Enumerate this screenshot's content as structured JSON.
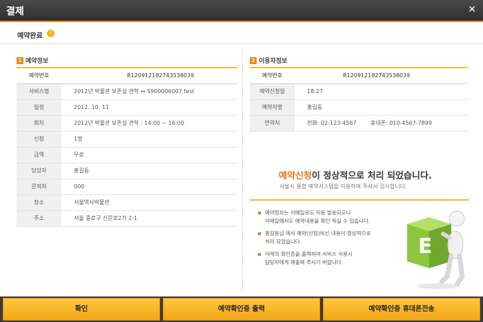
{
  "window": {
    "title": "결제",
    "close_glyph": "✕"
  },
  "header": {
    "label": "예약완료"
  },
  "reservation": {
    "section_num": "1",
    "section_title": "예약정보",
    "number_label": "예약번호",
    "number_value": "R120912182743538039",
    "rows": [
      {
        "label": "서비스명",
        "value": "2012년 박물관 보존실 견학 ↔ S900006007 test"
      },
      {
        "label": "일정",
        "value": "2012. 10. 11"
      },
      {
        "label": "회차",
        "value": "2012년 박물관 보존실 견학 : 14:00 ~ 16:00"
      },
      {
        "label": "신청",
        "value": "1명"
      },
      {
        "label": "금액",
        "value": "무료"
      },
      {
        "label": "담당자",
        "value": "홍길동"
      },
      {
        "label": "문의처",
        "value": "000"
      },
      {
        "label": "장소",
        "value": "서울역사박물관"
      },
      {
        "label": "주소",
        "value": "서울 중로구 신문로2가 2-1"
      }
    ]
  },
  "user": {
    "section_num": "2",
    "section_title": "이용자정보",
    "number_label": "예약번호",
    "number_value": "R120912182743538039",
    "rows": [
      {
        "label": "예약신청일",
        "value": "18:27"
      },
      {
        "label": "예약자명",
        "value": "홍길동"
      },
      {
        "label": "연락처",
        "value": "전화: 02-123-4567        휴대폰: 010-4567-7899"
      }
    ]
  },
  "message": {
    "main_highlight": "예약신청",
    "main_rest": "이 정상적으로 처리 되었습니다.",
    "sub": "서울시 통합 예약시스템을 이용하여 주셔서 감사합니다."
  },
  "notices": [
    {
      "line1": "예약정보는 이메일로도 자동 발송되오니",
      "line2": "이메일에서도 예약내용을 확인 하실 수 있습니다."
    },
    {
      "line1": "홍길동님 께서 예약(신청)하신 내용이 정상적으로",
      "line2": "처리 되었습니다."
    },
    {
      "line1": "아래의 확인증을 출력하여 서비스 이용시",
      "line2": "담당자에게 제출해 주시기 바랍니다."
    }
  ],
  "mascot": {
    "letter": "E"
  },
  "buttons": {
    "confirm": "확인",
    "print": "예약확인증 출력",
    "sms": "예약확인증 휴대폰전송"
  },
  "colors": {
    "accent": "#e8891b",
    "button": "#f6b21e",
    "titlebar": "#3a3a3a",
    "cube": "#8cc63e"
  }
}
